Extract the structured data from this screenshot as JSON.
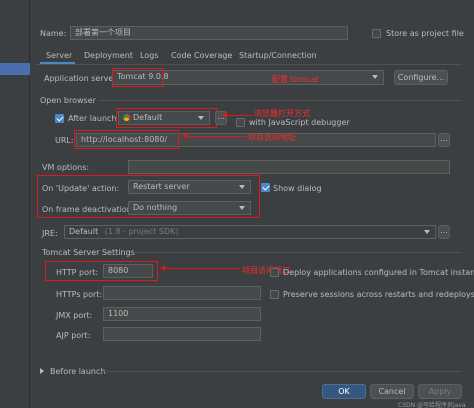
{
  "config": {
    "name_label": "Name:",
    "name_value": "部署第一个项目",
    "store_label": "Store as project file",
    "store_checked": false
  },
  "tabs": [
    "Server",
    "Deployment",
    "Logs",
    "Code Coverage",
    "Startup/Connection"
  ],
  "active_tab": "Server",
  "server": {
    "app_server_label": "Application server:",
    "app_server_value": "Tomcat 9.0.8",
    "configure_button": "Configure..."
  },
  "browser": {
    "section_label": "Open browser",
    "after_launch_label": "After launch",
    "after_launch_checked": true,
    "browser_value": "Default",
    "more_button": "...",
    "js_debugger_label": "with JavaScript debugger",
    "js_debugger_checked": false,
    "url_label": "URL:",
    "url_value": "http://localhost:8080/"
  },
  "vm": {
    "label": "VM options:",
    "value": ""
  },
  "actions": {
    "update_label": "On 'Update' action:",
    "update_value": "Restart server",
    "show_dialog_label": "Show dialog",
    "show_dialog_checked": true,
    "frame_label": "On frame deactivation:",
    "frame_value": "Do nothing"
  },
  "jre": {
    "label": "JRE:",
    "value": "Default",
    "hint": "(1.8 - project SDK)"
  },
  "tomcat": {
    "section_label": "Tomcat Server Settings",
    "http_port_label": "HTTP port:",
    "http_port_value": "8080",
    "deploy_label": "Deploy applications configured in Tomcat instance",
    "deploy_checked": false,
    "https_port_label": "HTTPs port:",
    "https_port_value": "",
    "preserve_label": "Preserve sessions across restarts and redeploys",
    "preserve_checked": false,
    "jmx_port_label": "JMX port:",
    "jmx_port_value": "1100",
    "ajp_port_label": "AJP port:",
    "ajp_port_value": ""
  },
  "before_launch": {
    "label": "Before launch"
  },
  "footer": {
    "ok_label": "OK",
    "cancel_label": "Cancel",
    "apply_label": "Apply"
  },
  "annotations": {
    "tomcat_note": "配置 tomcat",
    "browser_note": "浏览器打开方式",
    "url_note": "项目访问地址",
    "port_note": "项目访问端口"
  },
  "watermark": "CSDN @写给程序员Java"
}
